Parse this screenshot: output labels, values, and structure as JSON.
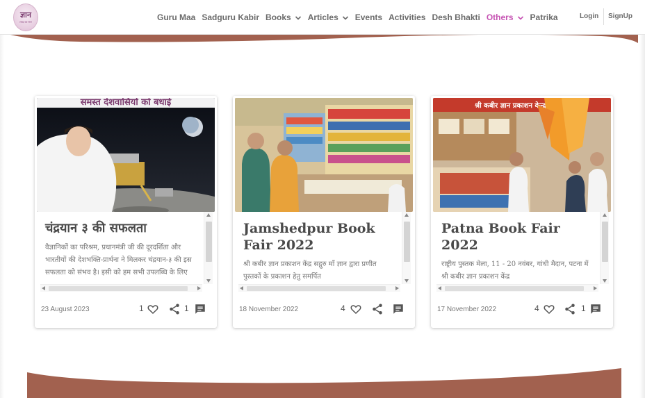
{
  "nav": {
    "logo_mark": "ज्ञान",
    "logo_sub": "शब्द का सार",
    "items": [
      {
        "label": "Guru Maa",
        "dropdown": false,
        "active": false
      },
      {
        "label": "Sadguru Kabir",
        "dropdown": false,
        "active": false
      },
      {
        "label": "Books",
        "dropdown": true,
        "active": false
      },
      {
        "label": "Articles",
        "dropdown": true,
        "active": false
      },
      {
        "label": "Events",
        "dropdown": false,
        "active": false
      },
      {
        "label": "Activities",
        "dropdown": false,
        "active": false
      },
      {
        "label": "Desh Bhakti",
        "dropdown": false,
        "active": false
      },
      {
        "label": "Others",
        "dropdown": true,
        "active": true
      },
      {
        "label": "Patrika",
        "dropdown": false,
        "active": false
      }
    ],
    "login": "Login",
    "signup": "SignUp",
    "active_color": "#c653b3"
  },
  "theme": {
    "band_color": "#a2614f",
    "text_muted": "#777777"
  },
  "cards": [
    {
      "image_caption": "समस्त देशवासियों को बधाई",
      "title": "चंद्रयान ३ की सफलता",
      "description": "वैज्ञानिकों का परिश्रम, प्रधानमंत्री जी की दूरदर्शिता और भारतीयों की देशभक्ति-प्रार्थना ने मिलकर चंद्रयान-३ की इस सफलता को संभव है। इसी को हम सभी उपलब्धि के लिए",
      "date": "23 August 2023",
      "likes": "1",
      "shares": "1",
      "comments": ""
    },
    {
      "image_caption": "",
      "title": "Jamshedpur Book Fair 2022",
      "description": "श्री कबीर ज्ञान प्रकाशन केंद्र सद्गुरु माँ ज्ञान द्वारा प्रणीत पुस्तकों के प्रकाशन हेतु समर्पित",
      "date": "18 November 2022",
      "likes": "4",
      "shares": "",
      "comments": ""
    },
    {
      "image_caption": "श्री कबीर ज्ञान प्रकाशन केन्द्र",
      "title": "Patna Book Fair 2022",
      "description": "राष्ट्रीय पुस्तक मेला, 11 - 20 नवंबर, गांधी मैदान, पटना में श्री कबीर ज्ञान प्रकाशन केंद्र",
      "date": "17 November 2022",
      "likes": "4",
      "shares": "1",
      "comments": ""
    }
  ]
}
